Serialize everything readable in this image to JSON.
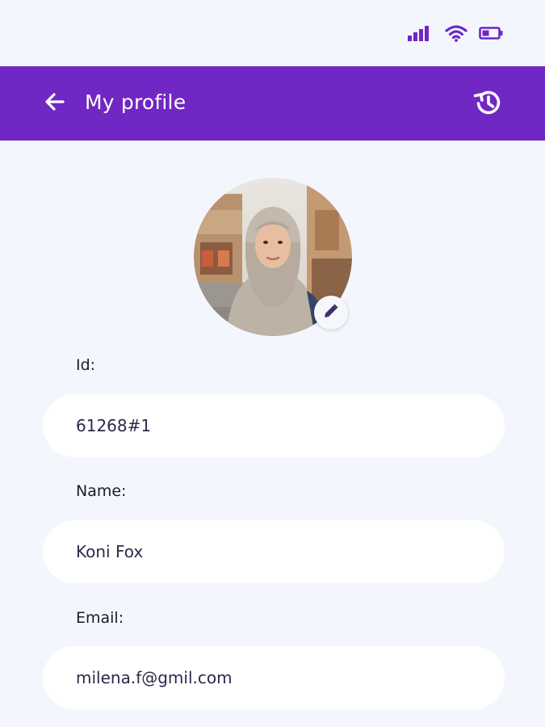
{
  "status_bar": {
    "accent": "#7027c4",
    "icons": [
      "signal-icon",
      "wifi-icon",
      "battery-icon"
    ]
  },
  "app_bar": {
    "title": "My profile",
    "background": "#7027c4",
    "left_icon": "back-arrow-icon",
    "right_icon": "history-icon"
  },
  "profile": {
    "avatar": "profile-photo",
    "edit_icon": "pencil-icon"
  },
  "fields": {
    "id": {
      "label": "Id:",
      "value": "61268#1"
    },
    "name": {
      "label": "Name:",
      "value": "Koni Fox"
    },
    "email": {
      "label": "Email:",
      "value": "milena.f@gmil.com"
    }
  }
}
